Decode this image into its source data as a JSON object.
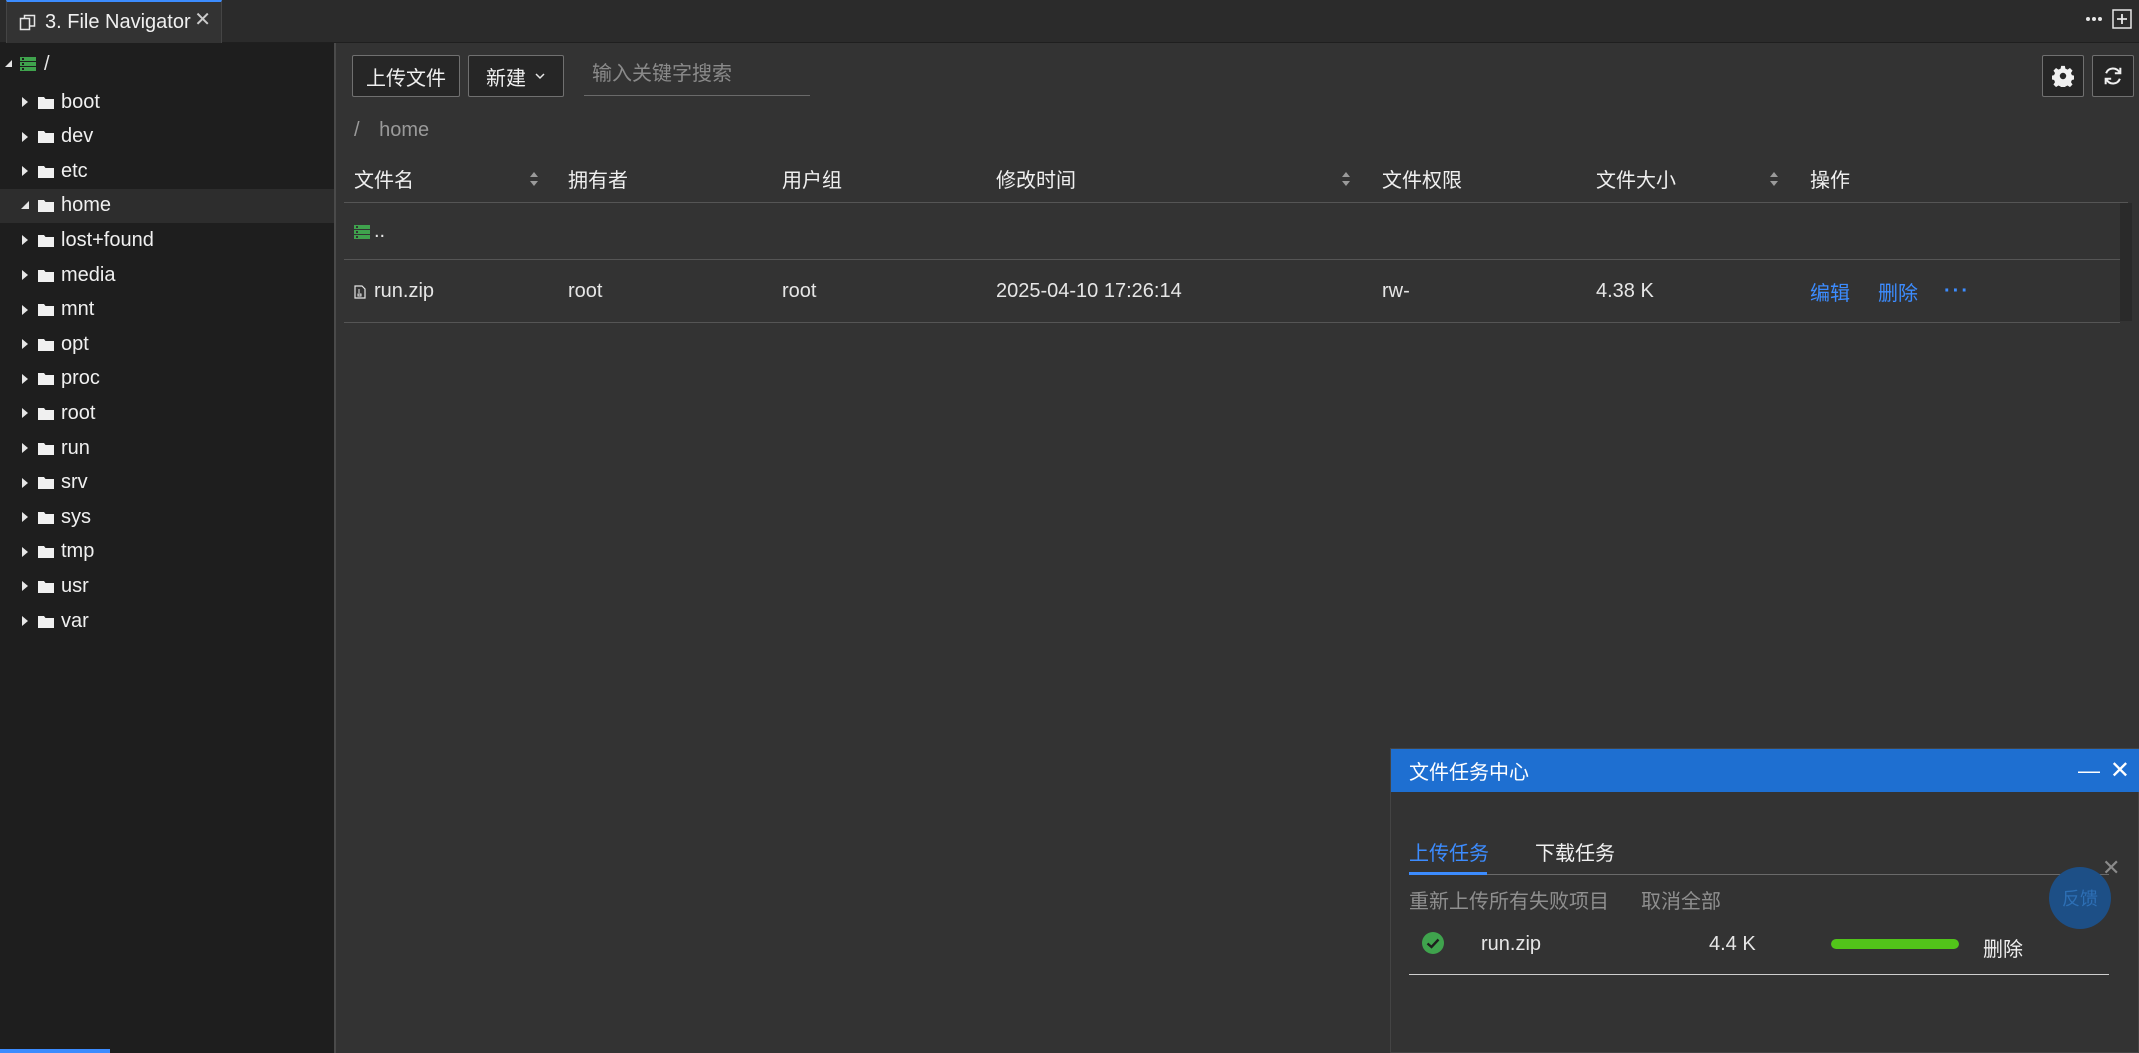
{
  "tabbar": {
    "tab_title": "3. File Navigator",
    "close": "✕"
  },
  "sidebar": {
    "root_label": "/",
    "items": [
      {
        "label": "boot"
      },
      {
        "label": "dev"
      },
      {
        "label": "etc"
      },
      {
        "label": "home",
        "expanded": true,
        "selected": true
      },
      {
        "label": "lost+found"
      },
      {
        "label": "media"
      },
      {
        "label": "mnt"
      },
      {
        "label": "opt"
      },
      {
        "label": "proc"
      },
      {
        "label": "root"
      },
      {
        "label": "run"
      },
      {
        "label": "srv"
      },
      {
        "label": "sys"
      },
      {
        "label": "tmp"
      },
      {
        "label": "usr"
      },
      {
        "label": "var"
      }
    ]
  },
  "toolbar": {
    "upload_label": "上传文件",
    "new_label": "新建",
    "search_placeholder": "输入关键字搜索"
  },
  "breadcrumb": {
    "sep": "/",
    "current": "home"
  },
  "table": {
    "columns": [
      "文件名",
      "拥有者",
      "用户组",
      "修改时间",
      "文件权限",
      "文件大小",
      "操作"
    ],
    "parent_label": "..",
    "rows": [
      {
        "name": "run.zip",
        "owner": "root",
        "group": "root",
        "mtime": "2025-04-10 17:26:14",
        "perm": "rw-",
        "size": "4.38 K",
        "edit": "编辑",
        "delete": "删除",
        "more": "···"
      }
    ]
  },
  "task_panel": {
    "title": "文件任务中心",
    "tabs": [
      "上传任务",
      "下载任务"
    ],
    "retry_label": "重新上传所有失败项目",
    "cancel_all_label": "取消全部",
    "tasks": [
      {
        "name": "run.zip",
        "size": "4.4 K",
        "progress": 1.0,
        "delete": "删除"
      }
    ]
  },
  "feedback": {
    "label": "反馈"
  },
  "colors": {
    "accent": "#3c8cff",
    "panel_header": "#1e6fd1",
    "success": "#52c41a",
    "folder_green": "#3fa34d"
  }
}
